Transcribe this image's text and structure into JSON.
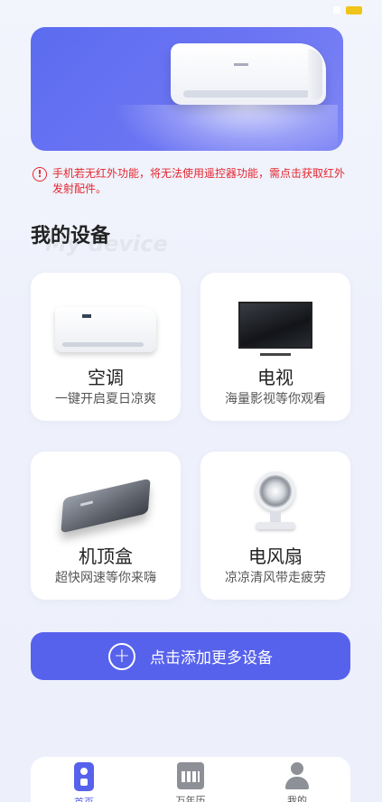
{
  "warning": {
    "icon": "exclamation-circle-icon",
    "text": "手机若无红外功能，将无法使用遥控器功能，需点击获取红外发射配件。"
  },
  "section": {
    "title": "我的设备",
    "subtitle": "My device"
  },
  "devices": [
    {
      "name": "空调",
      "desc": "一键开启夏日凉爽",
      "icon": "air-conditioner"
    },
    {
      "name": "电视",
      "desc": "海量影视等你观看",
      "icon": "television"
    },
    {
      "name": "机顶盒",
      "desc": "超快网速等你来嗨",
      "icon": "set-top-box"
    },
    {
      "name": "电风扇",
      "desc": "凉凉清风带走疲劳",
      "icon": "electric-fan"
    }
  ],
  "add_button": {
    "label": "点击添加更多设备",
    "icon": "plus-circle-icon"
  },
  "tabbar": {
    "items": [
      {
        "label": "首页",
        "icon": "remote-icon",
        "active": true
      },
      {
        "label": "万年历",
        "icon": "calendar-icon",
        "active": false
      },
      {
        "label": "我的",
        "icon": "user-icon",
        "active": false
      }
    ]
  },
  "colors": {
    "accent": "#5762ec",
    "warning": "#e5262f",
    "banner": "#6c75f3"
  }
}
